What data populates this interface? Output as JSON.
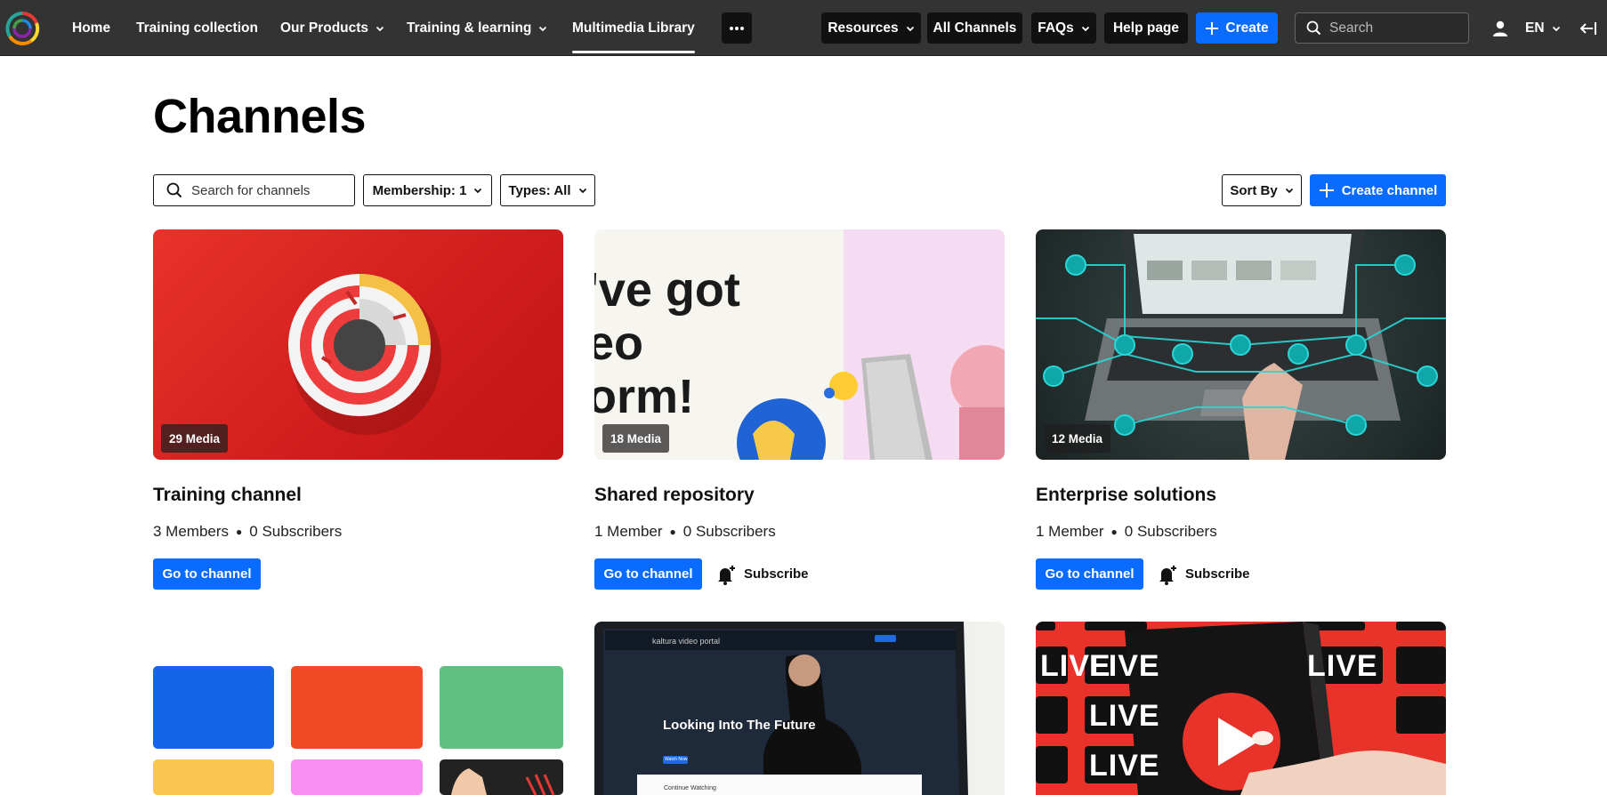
{
  "topbar": {
    "nav": [
      {
        "label": "Home"
      },
      {
        "label": "Training collection"
      },
      {
        "label": "Our Products"
      },
      {
        "label": "Training & learning"
      },
      {
        "label": "Multimedia Library"
      }
    ],
    "more_icon": "more-horizontal-icon",
    "pills": [
      {
        "label": "Resources"
      },
      {
        "label": "All Channels"
      },
      {
        "label": "FAQs"
      },
      {
        "label": "Help page"
      }
    ],
    "create_label": "Create",
    "search_placeholder": "Search",
    "language": "EN",
    "colors": {
      "bar": "#333333",
      "accent": "#0a6cff"
    }
  },
  "main": {
    "title": "Channels",
    "filters": {
      "search_placeholder": "Search for channels",
      "membership": "Membership: 1",
      "types": "Types: All",
      "sort": "Sort By",
      "create_channel": "Create channel"
    },
    "cards": [
      {
        "title": "Training channel",
        "media": "29 Media",
        "members": "3 Members",
        "subscribers": "0 Subscribers",
        "go": "Go to channel"
      },
      {
        "title": "Shared repository",
        "media": "18 Media",
        "members": "1 Member",
        "subscribers": "0 Subscribers",
        "go": "Go to channel",
        "subscribe": "Subscribe",
        "thumb_text": [
          "'ve got",
          "eo",
          "orm!"
        ]
      },
      {
        "title": "Enterprise solutions",
        "media": "12 Media",
        "members": "1 Member",
        "subscribers": "0 Subscribers",
        "go": "Go to channel",
        "subscribe": "Subscribe"
      }
    ],
    "row2": {
      "card5_thumb": {
        "brand": "kaltura video portal",
        "headline": "Looking Into The Future",
        "cta": "Watch Now",
        "section": "Continue Watching"
      },
      "card6_thumb": {
        "live": "LIVE"
      }
    }
  }
}
